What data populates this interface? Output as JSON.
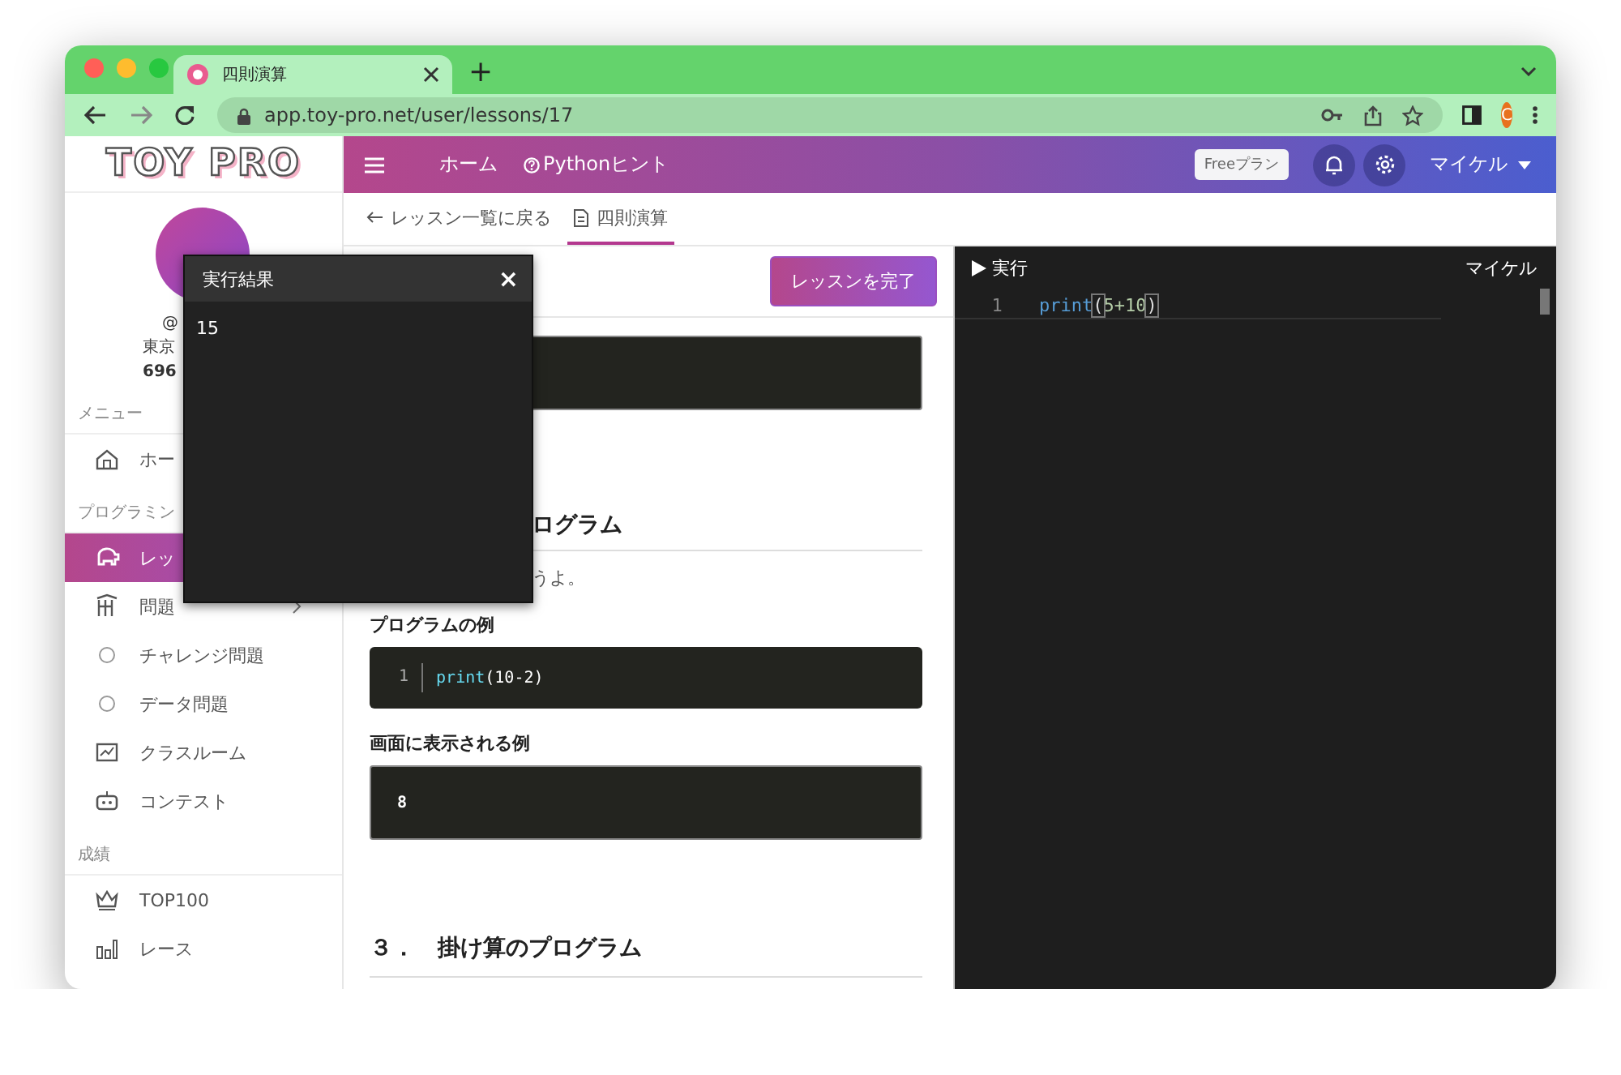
{
  "browser": {
    "tab_title": "四則演算",
    "new_tab": "+",
    "url": "app.toy-pro.net/user/lessons/17",
    "profile_initial": "C"
  },
  "logo": "TOY PRO",
  "profile": {
    "handle": "@",
    "location": "東京",
    "points": "696"
  },
  "sidebar": [
    {
      "label": "メニュー",
      "items": [
        {
          "label": "ホー",
          "kind": "link",
          "selected": false
        }
      ]
    },
    {
      "label": "プログラミン",
      "items": [
        {
          "label": "レッ",
          "kind": "link",
          "selected": true
        },
        {
          "label": "問題",
          "kind": "group",
          "expanded": false,
          "selected": false
        },
        {
          "label": "チャレンジ問題",
          "kind": "sub",
          "selected": false
        },
        {
          "label": "データ問題",
          "kind": "sub",
          "selected": false
        },
        {
          "label": "クラスルーム",
          "kind": "link",
          "selected": false
        },
        {
          "label": "コンテスト",
          "kind": "link",
          "selected": false
        }
      ]
    },
    {
      "label": "成績",
      "items": [
        {
          "label": "TOP100",
          "kind": "link",
          "selected": false
        },
        {
          "label": "レース",
          "kind": "link",
          "selected": false
        }
      ]
    }
  ],
  "header": {
    "nav": [
      {
        "label": "ホーム",
        "kind": "plain"
      },
      {
        "label": "Pythonヒント",
        "kind": "hint"
      }
    ],
    "plan": "Freeプラン",
    "user": "マイケル"
  },
  "breadcrumb": [
    {
      "label": "レッスン一覧に戻る",
      "kind": "back",
      "selected": false
    },
    {
      "label": "四則演算",
      "kind": "doc",
      "selected": true
    }
  ],
  "lesson": {
    "complete_button": "レッスンを完了",
    "blocks": [
      {
        "kind": "output"
      },
      {
        "kind": "heading",
        "text": "ログラム"
      },
      {
        "kind": "text",
        "text": "うよ。"
      },
      {
        "kind": "label",
        "text": "プログラムの例"
      },
      {
        "kind": "code",
        "lines": [
          {
            "number": "1",
            "tokens": [
              {
                "text": "print",
                "kind": "builtin"
              },
              {
                "text": "(10-2)",
                "kind": "plain"
              }
            ]
          }
        ]
      },
      {
        "kind": "label",
        "text": "画面に表示される例"
      },
      {
        "kind": "output",
        "lines": [
          "8"
        ]
      },
      {
        "kind": "heading",
        "text": "３．　掛け算のプログラム"
      }
    ]
  },
  "editor": {
    "run": "実行",
    "user": "マイケル",
    "lines": [
      {
        "number": "1",
        "tokens": [
          {
            "text": "print",
            "kind": "builtin"
          },
          {
            "text": "(",
            "kind": "bracket"
          },
          {
            "text": "5+10",
            "kind": "number"
          },
          {
            "text": ")",
            "kind": "bracket"
          }
        ]
      }
    ]
  },
  "result_popup": {
    "title": "実行結果",
    "close": "×",
    "output": "15"
  }
}
